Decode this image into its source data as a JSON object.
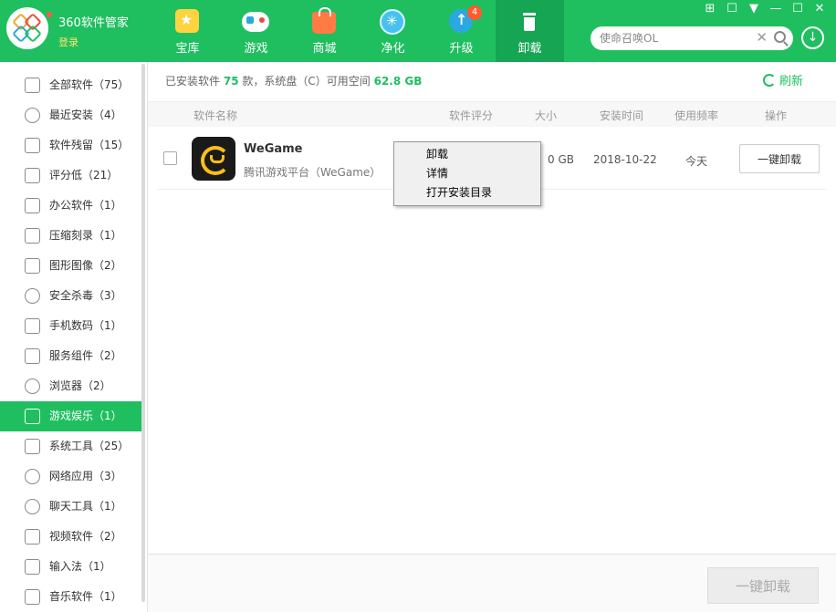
{
  "app": {
    "title": "360软件管家",
    "login": "登录"
  },
  "nav": [
    {
      "label": "宝库",
      "icon": "star-icon"
    },
    {
      "label": "游戏",
      "icon": "gamepad-icon"
    },
    {
      "label": "商城",
      "icon": "shopping-bag-icon"
    },
    {
      "label": "净化",
      "icon": "clean-icon"
    },
    {
      "label": "升级",
      "icon": "upgrade-arrow-icon",
      "badge": "4"
    },
    {
      "label": "卸载",
      "icon": "trash-icon",
      "active": true
    }
  ],
  "search": {
    "placeholder": "使命召唤OL"
  },
  "sidebar": {
    "items": [
      {
        "label": "全部软件（75）"
      },
      {
        "label": "最近安装（4）"
      },
      {
        "label": "软件残留（15）"
      },
      {
        "label": "评分低（21）"
      },
      {
        "label": "办公软件（1）"
      },
      {
        "label": "压缩刻录（1）"
      },
      {
        "label": "图形图像（2）"
      },
      {
        "label": "安全杀毒（3）"
      },
      {
        "label": "手机数码（1）"
      },
      {
        "label": "服务组件（2）"
      },
      {
        "label": "浏览器（2）"
      },
      {
        "label": "游戏娱乐（1）"
      },
      {
        "label": "系统工具（25）"
      },
      {
        "label": "网络应用（3）"
      },
      {
        "label": "聊天工具（1）"
      },
      {
        "label": "视频软件（2）"
      },
      {
        "label": "输入法（1）"
      },
      {
        "label": "音乐软件（1）"
      }
    ]
  },
  "summary": {
    "prefix": "已安装软件",
    "count": "75",
    "mid": "款，系统盘（C）可用空间",
    "space": "62.8 GB"
  },
  "refresh_label": "刷新",
  "table": {
    "headers": {
      "name": "软件名称",
      "rating": "软件评分",
      "size": "大小",
      "date": "安装时间",
      "freq": "使用频率",
      "action": "操作"
    },
    "rows": [
      {
        "name": "WeGame",
        "desc": "腾讯游戏平台（WeGame）",
        "size": "0 GB",
        "date": "2018-10-22",
        "freq": "今天",
        "action": "一键卸载"
      }
    ]
  },
  "context_menu": [
    "卸载",
    "详情",
    "打开安装目录"
  ],
  "footer": {
    "batch_label": "一键卸载"
  }
}
